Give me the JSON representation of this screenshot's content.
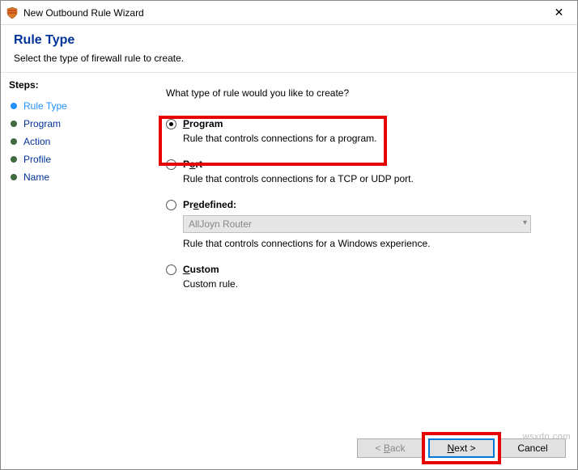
{
  "window": {
    "title": "New Outbound Rule Wizard",
    "close_glyph": "✕"
  },
  "header": {
    "title": "Rule Type",
    "subtitle": "Select the type of firewall rule to create."
  },
  "steps": {
    "heading": "Steps:",
    "items": [
      {
        "label": "Rule Type",
        "current": true
      },
      {
        "label": "Program",
        "current": false
      },
      {
        "label": "Action",
        "current": false
      },
      {
        "label": "Profile",
        "current": false
      },
      {
        "label": "Name",
        "current": false
      }
    ]
  },
  "content": {
    "prompt": "What type of rule would you like to create?",
    "options": {
      "program": {
        "label_pre": "P",
        "label_rest": "rogram",
        "desc": "Rule that controls connections for a program.",
        "selected": true
      },
      "port": {
        "label_pre": "",
        "label_u": "P",
        "label_rest2": "ort",
        "desc": "Rule that controls connections for a TCP or UDP port."
      },
      "predefined": {
        "label_pre": "Pr",
        "label_u": "e",
        "label_rest2": "defined:",
        "dropdown_value": "AllJoyn Router",
        "desc": "Rule that controls connections for a Windows experience."
      },
      "custom": {
        "label_u": "C",
        "label_rest2": "ustom",
        "desc": "Custom rule."
      }
    }
  },
  "buttons": {
    "back_pre": "< ",
    "back_u": "B",
    "back_rest": "ack",
    "next_u": "N",
    "next_rest": "ext >",
    "cancel": "Cancel"
  },
  "watermark": "wsxdn.com"
}
